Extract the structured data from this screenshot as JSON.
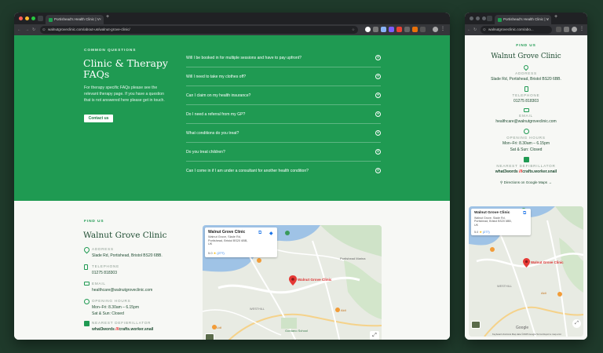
{
  "browser": {
    "desktop": {
      "tab_title": "Portishead's Health Clinic | V",
      "url": "walnutgroveclinic.com/about-us/walnut-grove-clinic/"
    },
    "mobile": {
      "tab_title": "Portishead's Health Clinic | V",
      "url": "walnutgroveclinic.com/abo..."
    }
  },
  "faq": {
    "eyebrow": "COMMON QUESTIONS",
    "title": "Clinic & Therapy FAQs",
    "intro": "For therapy specific FAQs please see the relevant therapy page. If you have a question that is not answered here please get in touch.",
    "contact_label": "Contact us",
    "questions": [
      "Will I be booked in for multiple sessions and have to pay upfront?",
      "Will I need to take my clothes off?",
      "Can I claim on my health insurance?",
      "Do I need a referral from my GP?",
      "What conditions do you treat?",
      "Do you treat children?",
      "Can I come in if I am under a consultant for another health condition?"
    ]
  },
  "findus": {
    "eyebrow": "FIND US",
    "title": "Walnut Grove Clinic",
    "address_label": "ADDRESS",
    "address": "Slade Rd, Portishead, Bristol BS20 6BB.",
    "phone_label": "TELEPHONE",
    "phone": "01275 818303",
    "email_label": "EMAIL",
    "email": "healthcare@walnutgroveclinic.com",
    "hours_label": "OPENING HOURS",
    "hours_weekday": "Mon–Fri: 8.30am – 6.15pm",
    "hours_weekend": "Sat & Sun: Closed",
    "defib_label": "NEAREST DEFIBRILLATOR",
    "defib_prefix": "what3words ",
    "defib_slash": "///",
    "defib_words": "crafts.worker.snail",
    "directions": "Directions on Google Maps"
  },
  "map": {
    "place": "Walnut Grove Clinic",
    "place_addr": "Walnut Grove, Slade Rd, Portishead, Bristol BS20 6BB, UK",
    "rating": "5.0",
    "stars": "★",
    "reviews": "(277)",
    "pin_label": "Walnut Grove Clinic",
    "label_aldi": "Aldi",
    "label_lidl": "Lidl",
    "label_gordano": "Gordano School",
    "label_albion": "Albion",
    "label_wellhouse": "WESTHILL",
    "label_portishead": "Portishead Marina",
    "label_redcliff": "Redcliff Bay",
    "google": "Google",
    "footer": "Keyboard shortcuts   Map data ©2025 Google   Terms   Report a map error"
  },
  "colors": {
    "green": "#1f9a52",
    "dark_green": "#1f4d32",
    "bg": "#1f3a2b"
  }
}
